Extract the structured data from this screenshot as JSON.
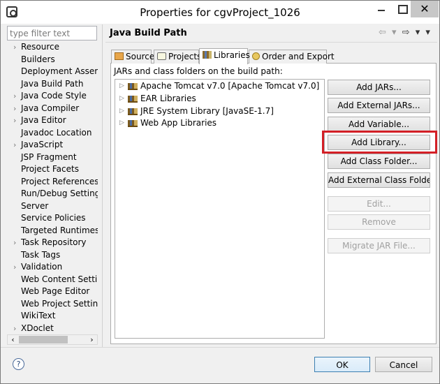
{
  "window": {
    "title": "Properties for cgvProject_1026",
    "close_glyph": "✕"
  },
  "sidebar": {
    "filter_placeholder": "type filter text",
    "items": [
      {
        "label": "Resource",
        "expandable": true
      },
      {
        "label": "Builders",
        "expandable": false
      },
      {
        "label": "Deployment Assembl",
        "expandable": false
      },
      {
        "label": "Java Build Path",
        "expandable": false,
        "selected": true
      },
      {
        "label": "Java Code Style",
        "expandable": true
      },
      {
        "label": "Java Compiler",
        "expandable": true
      },
      {
        "label": "Java Editor",
        "expandable": true
      },
      {
        "label": "Javadoc Location",
        "expandable": false
      },
      {
        "label": "JavaScript",
        "expandable": true
      },
      {
        "label": "JSP Fragment",
        "expandable": false
      },
      {
        "label": "Project Facets",
        "expandable": false
      },
      {
        "label": "Project References",
        "expandable": false
      },
      {
        "label": "Run/Debug Settings",
        "expandable": false
      },
      {
        "label": "Server",
        "expandable": false
      },
      {
        "label": "Service Policies",
        "expandable": false
      },
      {
        "label": "Targeted Runtimes",
        "expandable": false
      },
      {
        "label": "Task Repository",
        "expandable": true
      },
      {
        "label": "Task Tags",
        "expandable": false
      },
      {
        "label": "Validation",
        "expandable": true
      },
      {
        "label": "Web Content Setting",
        "expandable": false
      },
      {
        "label": "Web Page Editor",
        "expandable": false
      },
      {
        "label": "Web Project Settings",
        "expandable": false
      },
      {
        "label": "WikiText",
        "expandable": false
      },
      {
        "label": "XDoclet",
        "expandable": true
      }
    ],
    "scroll_left": "‹",
    "scroll_right": "›"
  },
  "page": {
    "title": "Java Build Path",
    "nav_back": "⇦ ▾",
    "nav_forward": "⇨ ▾ ▾",
    "tabs": [
      {
        "label": "Source",
        "icon": "source-folder-icon"
      },
      {
        "label": "Projects",
        "icon": "projects-icon"
      },
      {
        "label": "Libraries",
        "icon": "libraries-icon",
        "active": true
      },
      {
        "label": "Order and Export",
        "icon": "order-export-icon"
      }
    ],
    "list_caption": "JARs and class folders on the build path:",
    "libraries": [
      "Apache Tomcat v7.0 [Apache Tomcat v7.0]",
      "EAR Libraries",
      "JRE System Library [JavaSE-1.7]",
      "Web App Libraries"
    ],
    "buttons": [
      {
        "label": "Add JARs...",
        "enabled": true
      },
      {
        "label": "Add External JARs...",
        "enabled": true
      },
      {
        "label": "Add Variable...",
        "enabled": true
      },
      {
        "label": "Add Library...",
        "enabled": true,
        "highlighted": true
      },
      {
        "label": "Add Class Folder...",
        "enabled": true
      },
      {
        "label": "Add External Class Folder...",
        "enabled": true
      },
      {
        "label": "Edit...",
        "enabled": false
      },
      {
        "label": "Remove",
        "enabled": false
      },
      {
        "label": "Migrate JAR File...",
        "enabled": false
      }
    ],
    "highlight_color": "#d31f26"
  },
  "footer": {
    "help_glyph": "?",
    "ok_label": "OK",
    "cancel_label": "Cancel"
  }
}
